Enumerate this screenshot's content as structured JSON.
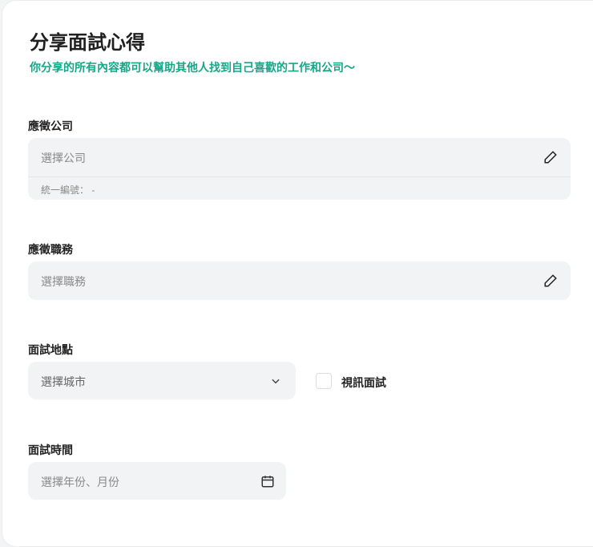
{
  "header": {
    "title": "分享面試心得",
    "subtitle": "你分享的所有內容都可以幫助其他人找到自己喜歡的工作和公司～"
  },
  "company": {
    "label": "應徵公司",
    "placeholder": "選擇公司",
    "tax_id": "統一編號： -"
  },
  "job": {
    "label": "應徵職務",
    "placeholder": "選擇職務"
  },
  "location": {
    "label": "面試地點",
    "placeholder": "選擇城市",
    "video_label": "視訊面試"
  },
  "time": {
    "label": "面試時間",
    "placeholder": "選擇年份、月份"
  }
}
